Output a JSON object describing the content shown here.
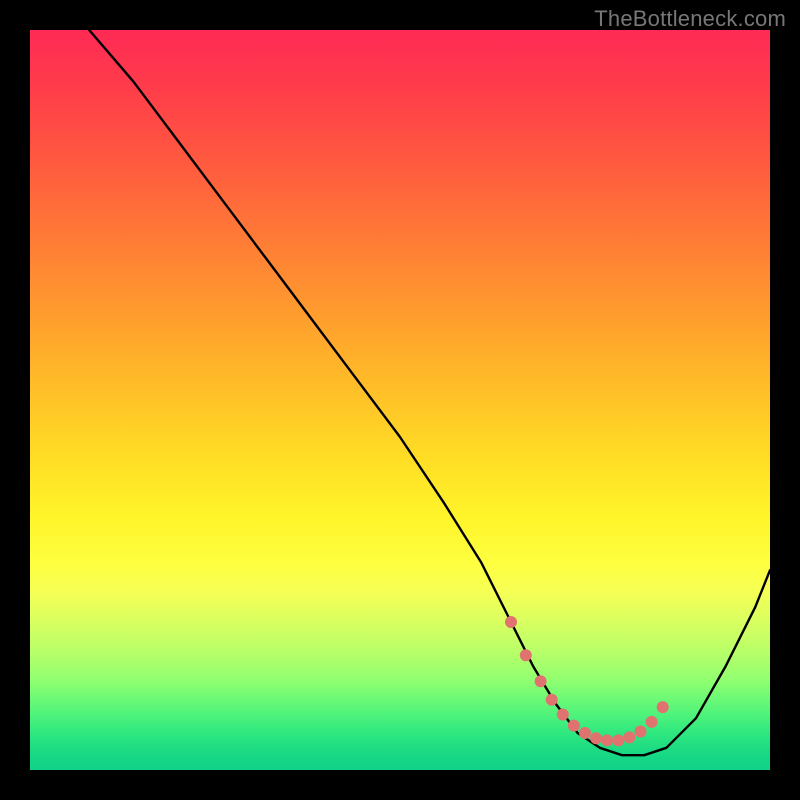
{
  "watermark": "TheBottleneck.com",
  "chart_data": {
    "type": "line",
    "title": "",
    "xlabel": "",
    "ylabel": "",
    "xlim": [
      0,
      100
    ],
    "ylim": [
      0,
      100
    ],
    "series": [
      {
        "name": "bottleneck-curve",
        "x": [
          8,
          14,
          20,
          26,
          32,
          38,
          44,
          50,
          56,
          61,
          65,
          68,
          71,
          74,
          77,
          80,
          83,
          86,
          90,
          94,
          98,
          100
        ],
        "y": [
          100,
          93,
          85,
          77,
          69,
          61,
          53,
          45,
          36,
          28,
          20,
          14,
          9,
          5,
          3,
          2,
          2,
          3,
          7,
          14,
          22,
          27
        ]
      }
    ],
    "optimum_markers": {
      "name": "optimum-zone-dots",
      "x": [
        65,
        67,
        69,
        70.5,
        72,
        73.5,
        75,
        76.5,
        78,
        79.5,
        81,
        82.5,
        84,
        85.5
      ],
      "y": [
        20,
        15.5,
        12,
        9.5,
        7.5,
        6,
        5,
        4.3,
        4,
        4,
        4.4,
        5.2,
        6.5,
        8.5
      ]
    },
    "gradient_stops": [
      {
        "pos": 0,
        "color": "#ff2a55"
      },
      {
        "pos": 8,
        "color": "#ff3d4a"
      },
      {
        "pos": 18,
        "color": "#ff5a3f"
      },
      {
        "pos": 28,
        "color": "#ff7a36"
      },
      {
        "pos": 38,
        "color": "#ff9b2e"
      },
      {
        "pos": 48,
        "color": "#ffbd28"
      },
      {
        "pos": 58,
        "color": "#ffde25"
      },
      {
        "pos": 66,
        "color": "#fff52a"
      },
      {
        "pos": 72,
        "color": "#feff40"
      },
      {
        "pos": 76,
        "color": "#f5ff55"
      },
      {
        "pos": 80,
        "color": "#d8ff60"
      },
      {
        "pos": 84,
        "color": "#b8ff68"
      },
      {
        "pos": 88,
        "color": "#8fff70"
      },
      {
        "pos": 92,
        "color": "#55f57a"
      },
      {
        "pos": 95,
        "color": "#2fe87f"
      },
      {
        "pos": 97,
        "color": "#1fdc82"
      },
      {
        "pos": 98.5,
        "color": "#15d686"
      },
      {
        "pos": 100,
        "color": "#10d288"
      }
    ],
    "marker_color": "#e0736f",
    "curve_color": "#000000"
  }
}
